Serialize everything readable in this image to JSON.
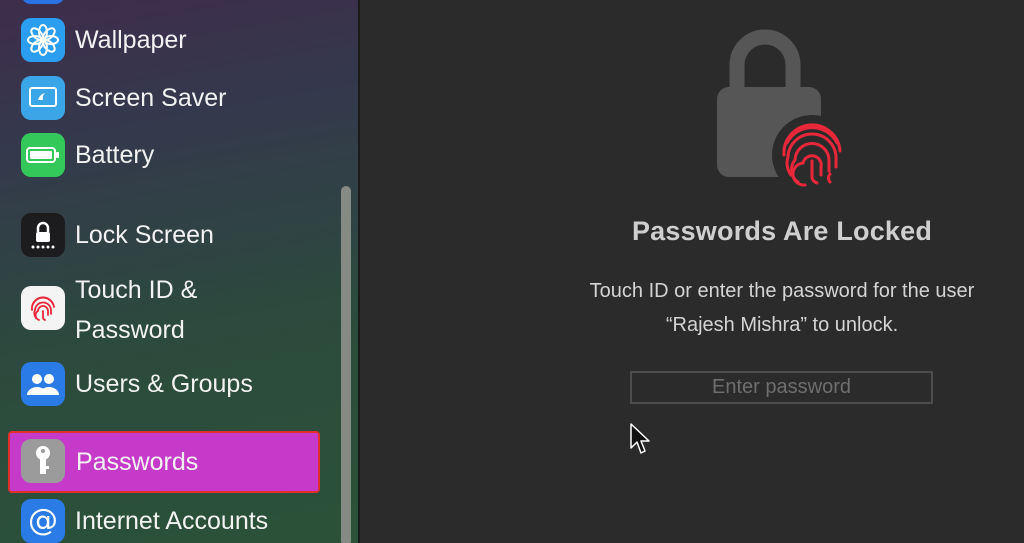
{
  "sidebar": {
    "items": [
      {
        "label": "Wallpaper",
        "icon": "wallpaper-icon",
        "color": "#2b9ef0"
      },
      {
        "label": "Screen Saver",
        "icon": "screen-saver-icon",
        "color": "#3aa6e8"
      },
      {
        "label": "Battery",
        "icon": "battery-icon",
        "color": "#34c759"
      },
      {
        "label": "Lock Screen",
        "icon": "lock-screen-icon",
        "color": "#1c1c1e"
      },
      {
        "label_line1": "Touch ID &",
        "label_line2": "Password",
        "icon": "fingerprint-icon",
        "color": "#f4f4f4"
      },
      {
        "label": "Users & Groups",
        "icon": "users-groups-icon",
        "color": "#2a7be6"
      },
      {
        "label": "Passwords",
        "icon": "key-icon",
        "color": "#9b9b9b",
        "selected": true
      },
      {
        "label": "Internet Accounts",
        "icon": "at-sign-icon",
        "color": "#2a7be6"
      }
    ]
  },
  "main": {
    "title": "Passwords Are Locked",
    "message_line1": "Touch ID or enter the password for the user",
    "message_line2": "“Rajesh Mishra” to unlock.",
    "password_placeholder": "Enter password"
  },
  "colors": {
    "selected_bg": "#c53ac9",
    "highlight_border": "#e0302d",
    "fingerprint": "#e8283a"
  }
}
